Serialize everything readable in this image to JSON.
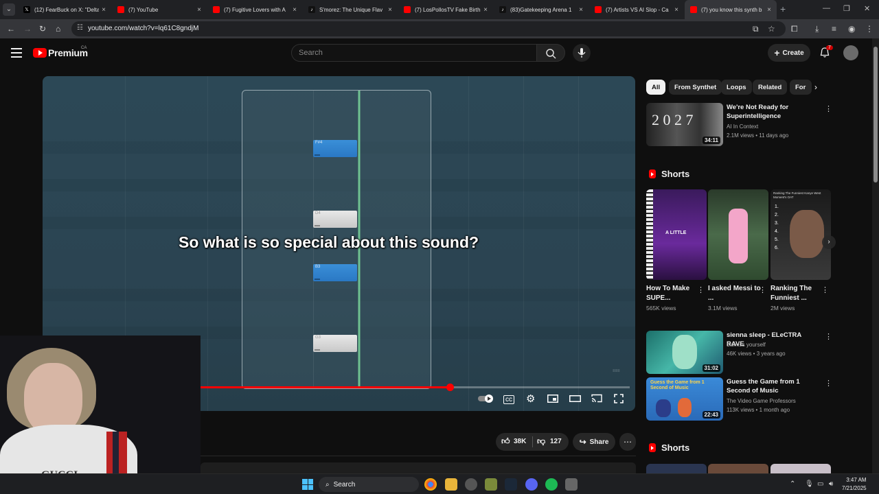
{
  "browser": {
    "tabs": [
      {
        "title": "(12) FearBuck on X: \"Delta",
        "favicon": "x",
        "active": false
      },
      {
        "title": "(7) YouTube",
        "favicon": "youtube",
        "active": false
      },
      {
        "title": "(7) Fugitive Lovers with A",
        "favicon": "youtube",
        "active": false
      },
      {
        "title": "S'morez: The Unique Flav",
        "favicon": "tiktok",
        "active": false
      },
      {
        "title": "(7) LosPollosTV Fake Birth",
        "favicon": "youtube",
        "active": false
      },
      {
        "title": "(83)Gatekeeping Arena 1",
        "favicon": "tiktok",
        "active": false
      },
      {
        "title": "(7) Artists VS AI Slop - Ca",
        "favicon": "youtube",
        "active": false
      },
      {
        "title": "(7) you know this synth b",
        "favicon": "youtube",
        "active": true
      }
    ],
    "close_glyph": "×",
    "new_tab_glyph": "+",
    "url": "youtube.com/watch?v=lq61C8gndjM"
  },
  "youtube": {
    "logo_text": "Premium",
    "region": "CA",
    "search_placeholder": "Search",
    "create_label": "Create",
    "notification_count": "7"
  },
  "video": {
    "caption": "So what is so special about this sound?",
    "notes": [
      {
        "label": "F#4",
        "color": "blue"
      },
      {
        "label": "D4",
        "color": "white"
      },
      {
        "label": "B3",
        "color": "blue"
      },
      {
        "label": "G3",
        "color": "white"
      }
    ],
    "progress_fraction": 0.58,
    "likes": "38K",
    "dislikes": "127",
    "share_label": "Share"
  },
  "webcam": {
    "shirt_text": "GUCCI"
  },
  "sidebar": {
    "chips": [
      {
        "label": "All",
        "active": true
      },
      {
        "label": "From Synthet",
        "active": false
      },
      {
        "label": "Loops",
        "active": false
      },
      {
        "label": "Related",
        "active": false
      },
      {
        "label": "For",
        "active": false
      }
    ],
    "video1": {
      "title": "We're Not Ready for Superintelligence",
      "channel": "AI In Context",
      "meta": "2.1M views • 11 days ago",
      "duration": "34:11"
    },
    "shorts_title": "Shorts",
    "shorts": [
      {
        "title": "How To Make SUPE...",
        "views": "565K views",
        "overlay": "A LITTLE"
      },
      {
        "title": "I asked Messi to ...",
        "views": "3.1M views",
        "overlay": ""
      },
      {
        "title": "Ranking The Funniest ...",
        "views": "2M views",
        "overlay": "Ranking The Funniest Kanye West Moment's OAT"
      }
    ],
    "video2": {
      "title": "sienna sleep - ELeCTRA RAVE",
      "channel": "dismiss yourself",
      "meta": "46K views • 3 years ago",
      "duration": "31:02"
    },
    "video3": {
      "title": "Guess the Game from 1 Second of Music",
      "channel": "The Video Game Professors",
      "meta": "113K views • 1 month ago",
      "duration": "22:43"
    },
    "shorts_title_2": "Shorts"
  },
  "taskbar": {
    "search_label": "Search",
    "time": "3:47 AM",
    "date": "7/21/2025"
  },
  "colors": {
    "yt_red": "#ff0000",
    "note_blue": "#2a78c4",
    "background": "#0f0f0f"
  }
}
